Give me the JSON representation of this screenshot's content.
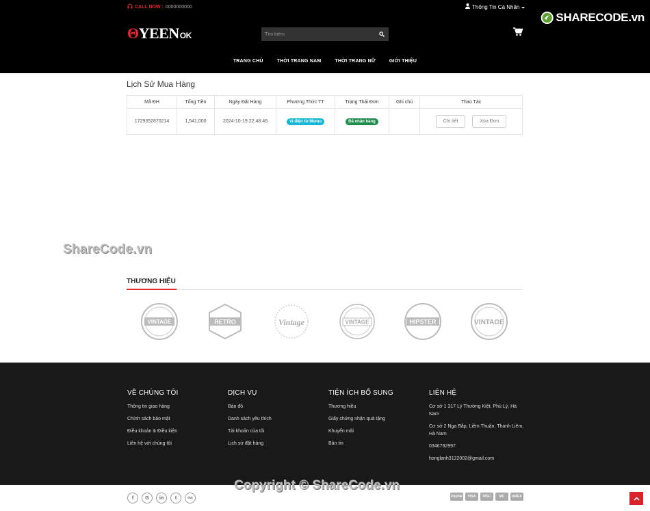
{
  "header": {
    "call_label": "CALL NOW :",
    "phone": "0000000000",
    "account_label": "Thông Tin Cá Nhân",
    "logo_main": "YEEN",
    "logo_suffix": "OK",
    "search_placeholder": "Tìm kiếm",
    "nav": [
      "TRANG CHỦ",
      "THỜI TRANG NAM",
      "THỜI TRANG NỮ",
      "GIỚI THIỆU"
    ],
    "watermark_logo": "SHARECODE.vn"
  },
  "page_title": "Lịch Sử Mua Hàng",
  "orders": {
    "headers": [
      "Mã ĐH",
      "Tổng Tiền",
      "Ngày Đặt Hàng",
      "Phương Thức TT",
      "Trạng Thái Đơn",
      "Ghi chú",
      "Thao Tác"
    ],
    "rows": [
      {
        "id": "1729352870214",
        "total": "1,541,000",
        "date": "2024-10-19 22:48:46",
        "method": "Ví điện tử Momo",
        "status": "Đã nhận hàng",
        "note": "",
        "detail_btn": "Chi tiết",
        "delete_btn": "Xóa Đơn"
      }
    ]
  },
  "watermark_mid": "ShareCode.vn",
  "brands": {
    "title": "THƯƠNG HIỆU",
    "items": [
      "VINTAGE",
      "RETRO",
      "Vintage",
      "VINTAGE",
      "HIPSTER",
      "VINTAGE"
    ]
  },
  "footer": {
    "about": {
      "title": "VỀ CHÚNG TÔI",
      "items": [
        "Thông tin giao hàng",
        "Chính sách bảo mật",
        "Điều khoản & Điều kiện",
        "Liên hệ với chúng tôi"
      ]
    },
    "services": {
      "title": "DỊCH VỤ",
      "items": [
        "Bản đồ",
        "Danh sách yêu thích",
        "Tài khoản của tôi",
        "Lịch sử đặt hàng"
      ]
    },
    "extras": {
      "title": "TIỆN ÍCH BỔ SUNG",
      "items": [
        "Thương hiệu",
        "Giấy chứng nhận quà tặng",
        "Khuyến mãi",
        "Bản tin"
      ]
    },
    "contact": {
      "title": "LIÊN HỆ",
      "items": [
        "Cơ sở 1 317 Lý Thường Kiệt, Phủ Lý, Hà Nam",
        "Cơ sở 2 Nga Bắp, Liêm Thuận, Thanh Liêm, Hà Nam",
        "0346792997",
        "honglanh3122002@gmail.com"
      ]
    }
  },
  "bottom": {
    "socials": [
      "f",
      "G",
      "in",
      "t",
      "rss"
    ],
    "copyright": "Copyright © ShareCode.vn",
    "payments": [
      "PayPal",
      "VISA",
      "DISC",
      "MC",
      "AMEX"
    ]
  }
}
